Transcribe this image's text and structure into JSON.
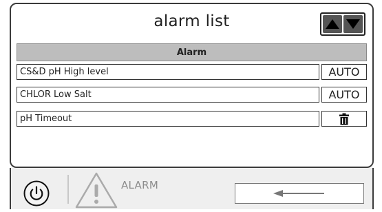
{
  "header": {
    "title": "alarm list"
  },
  "table": {
    "column_header": "Alarm",
    "rows": [
      {
        "label": "CS&D pH High level",
        "action": "AUTO",
        "action_type": "text"
      },
      {
        "label": "CHLOR Low Salt",
        "action": "AUTO",
        "action_type": "text"
      },
      {
        "label": "pH Timeout",
        "action": "",
        "action_type": "trash-icon"
      }
    ]
  },
  "footer": {
    "alarm_label": "ALARM",
    "icons": {
      "power": "power-icon",
      "warning": "warning-triangle-icon",
      "back": "left-arrow-icon"
    }
  },
  "colors": {
    "panel_border": "#3b3b3b",
    "header_bg": "#bdbdbd",
    "scroll_button": "#555555",
    "footer_bg": "#efefef",
    "alarm_text": "#8c8c8c"
  }
}
